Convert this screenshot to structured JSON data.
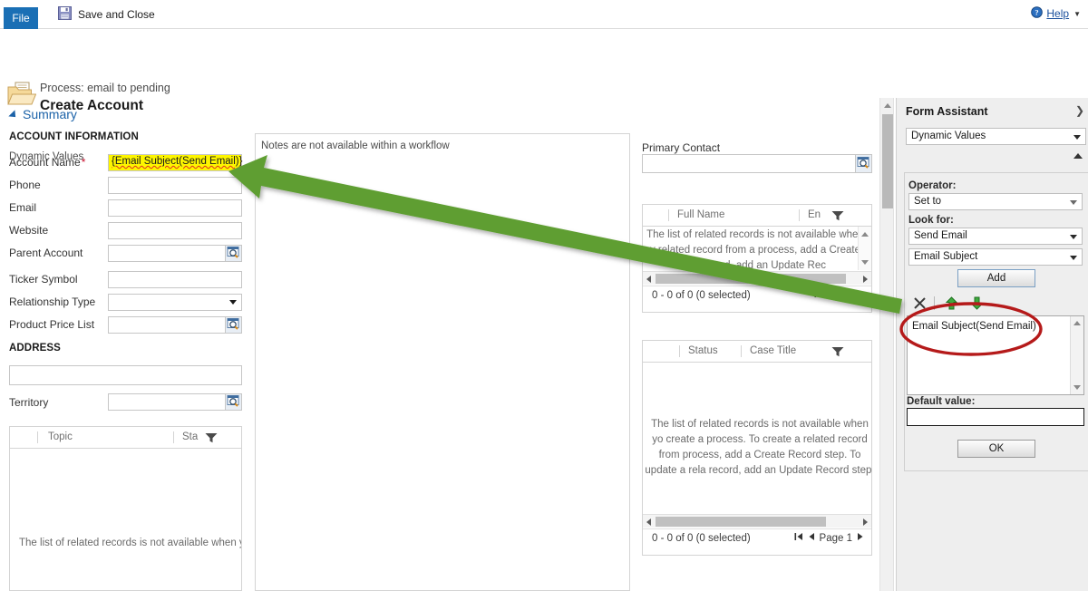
{
  "ribbon": {
    "file_tab": "File",
    "save_and_close": "Save and Close",
    "save_icon": "floppy-disk-icon",
    "help_label_prefix": "",
    "help_label": "Help",
    "help_icon": "help-circle-icon",
    "help_caret": "▼"
  },
  "process": {
    "subtitle": "Process: email to pending",
    "title": "Create Account",
    "icon": "folder-icon"
  },
  "form": {
    "summary_label": "Summary",
    "account_section_label": "ACCOUNT INFORMATION",
    "address_section_label": "ADDRESS",
    "fields": [
      {
        "label": "Account Name",
        "required": true,
        "value": "{Email Subject(Send Email)}",
        "highlight": true,
        "control": "text"
      },
      {
        "label": "Phone",
        "required": false,
        "value": "",
        "control": "text"
      },
      {
        "label": "Email",
        "required": false,
        "value": "",
        "control": "text"
      },
      {
        "label": "Website",
        "required": false,
        "value": "",
        "control": "text"
      },
      {
        "label": "Parent Account",
        "required": false,
        "value": "",
        "control": "lookup"
      },
      {
        "label": "Ticker Symbol",
        "required": false,
        "value": "",
        "control": "text"
      },
      {
        "label": "Relationship Type",
        "required": false,
        "value": "",
        "control": "dropdown"
      },
      {
        "label": "Product Price List",
        "required": false,
        "value": "",
        "control": "lookup"
      }
    ],
    "address_street_value": "",
    "territory_label": "Territory",
    "territory_value": ""
  },
  "notes_panel": {
    "message": "Notes are not available within a workflow"
  },
  "primary_contact": {
    "label": "Primary Contact",
    "value": ""
  },
  "grids": {
    "topic_grid": {
      "columns": [
        "Topic",
        "Sta"
      ],
      "empty_message": "The list of related records is not available when you"
    },
    "contact_grid": {
      "columns": [
        "Full Name",
        "En"
      ],
      "empty_message": "The list of related records is not available when y related record from a process, add a Create Re record, add an Update Rec",
      "count_text": "0 - 0 of 0 (0 selected)",
      "page_label": "Page"
    },
    "case_grid": {
      "columns": [
        "Status",
        "Case Title"
      ],
      "empty_message": "The list of related records is not available when yo create a process. To create a related record from process, add a Create Record step. To update a rela record, add an Update Record step.",
      "count_text": "0 - 0 of 0 (0 selected)",
      "page_label": "Page 1"
    },
    "filter_icon": "funnel-filter-icon"
  },
  "form_assistant": {
    "title": "Form Assistant",
    "expand_icon": "chevron-right-icon",
    "type_selector": "Dynamic Values",
    "section_label": "Dynamic Values",
    "collapse_icon": "chevron-up-icon",
    "operator_label": "Operator:",
    "operator_value": "Set to",
    "look_for_label": "Look for:",
    "look_for_entity": "Send Email",
    "look_for_field": "Email Subject",
    "add_button": "Add",
    "toolbar": {
      "delete_icon": "delete-x-icon",
      "move_up_icon": "green-up-arrow-icon",
      "move_down_icon": "green-down-arrow-icon"
    },
    "selected_items": [
      "Email Subject(Send Email)"
    ],
    "default_value_label": "Default value:",
    "default_value": "",
    "ok_button": "OK"
  },
  "annotations": {
    "arrow_color": "#5e9e32",
    "ellipse_color": "#b51a1a",
    "highlight_color": "#fdf500"
  }
}
